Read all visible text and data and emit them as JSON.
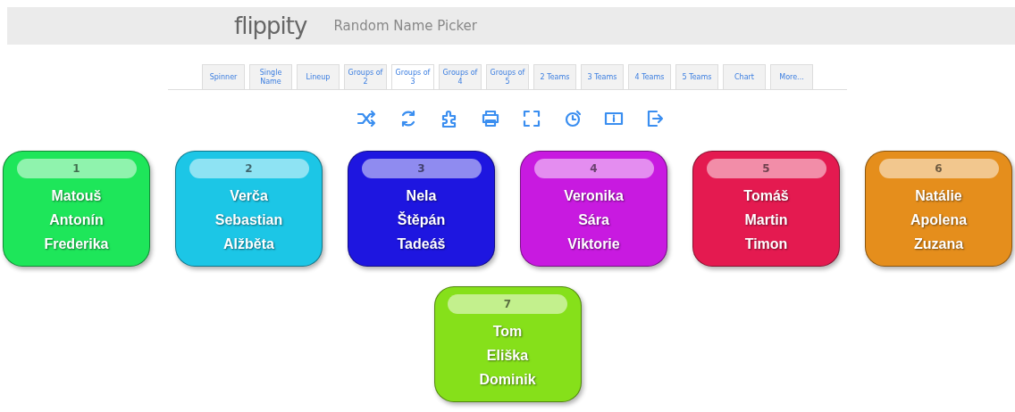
{
  "header": {
    "logo": "flippity",
    "title": "Random Name Picker"
  },
  "tabs": [
    {
      "label": "Spinner",
      "selected": false
    },
    {
      "label": "Single Name",
      "selected": false
    },
    {
      "label": "Lineup",
      "selected": false
    },
    {
      "label": "Groups of 2",
      "selected": false
    },
    {
      "label": "Groups of 3",
      "selected": true
    },
    {
      "label": "Groups of 4",
      "selected": false
    },
    {
      "label": "Groups of 5",
      "selected": false
    },
    {
      "label": "2 Teams",
      "selected": false
    },
    {
      "label": "3 Teams",
      "selected": false
    },
    {
      "label": "4 Teams",
      "selected": false
    },
    {
      "label": "5 Teams",
      "selected": false
    },
    {
      "label": "Chart",
      "selected": false
    },
    {
      "label": "More...",
      "selected": false
    }
  ],
  "toolbar": [
    {
      "kind": "shuffle"
    },
    {
      "kind": "refresh"
    },
    {
      "kind": "puzzle"
    },
    {
      "kind": "print"
    },
    {
      "kind": "fullscreen"
    },
    {
      "kind": "timer"
    },
    {
      "kind": "info"
    },
    {
      "kind": "exit"
    }
  ],
  "groups": [
    {
      "number": "1",
      "color": "#1ee65a",
      "names": [
        "Matouš",
        "Antonín",
        "Frederika"
      ]
    },
    {
      "number": "2",
      "color": "#1cc6e6",
      "names": [
        "Verča",
        "Sebastian",
        "Alžběta"
      ]
    },
    {
      "number": "3",
      "color": "#1e16e0",
      "names": [
        "Nela",
        "Štěpán",
        "Tadeáš"
      ]
    },
    {
      "number": "4",
      "color": "#c81ae0",
      "names": [
        "Veronika",
        "Sára",
        "Viktorie"
      ]
    },
    {
      "number": "5",
      "color": "#e41a50",
      "names": [
        "Tomáš",
        "Martin",
        "Timon"
      ]
    },
    {
      "number": "6",
      "color": "#e58e1c",
      "names": [
        "Natálie",
        "Apolena",
        "Zuzana"
      ]
    },
    {
      "number": "7",
      "color": "#86e01a",
      "names": [
        "Tom",
        "Eliška",
        "Dominik"
      ]
    }
  ]
}
